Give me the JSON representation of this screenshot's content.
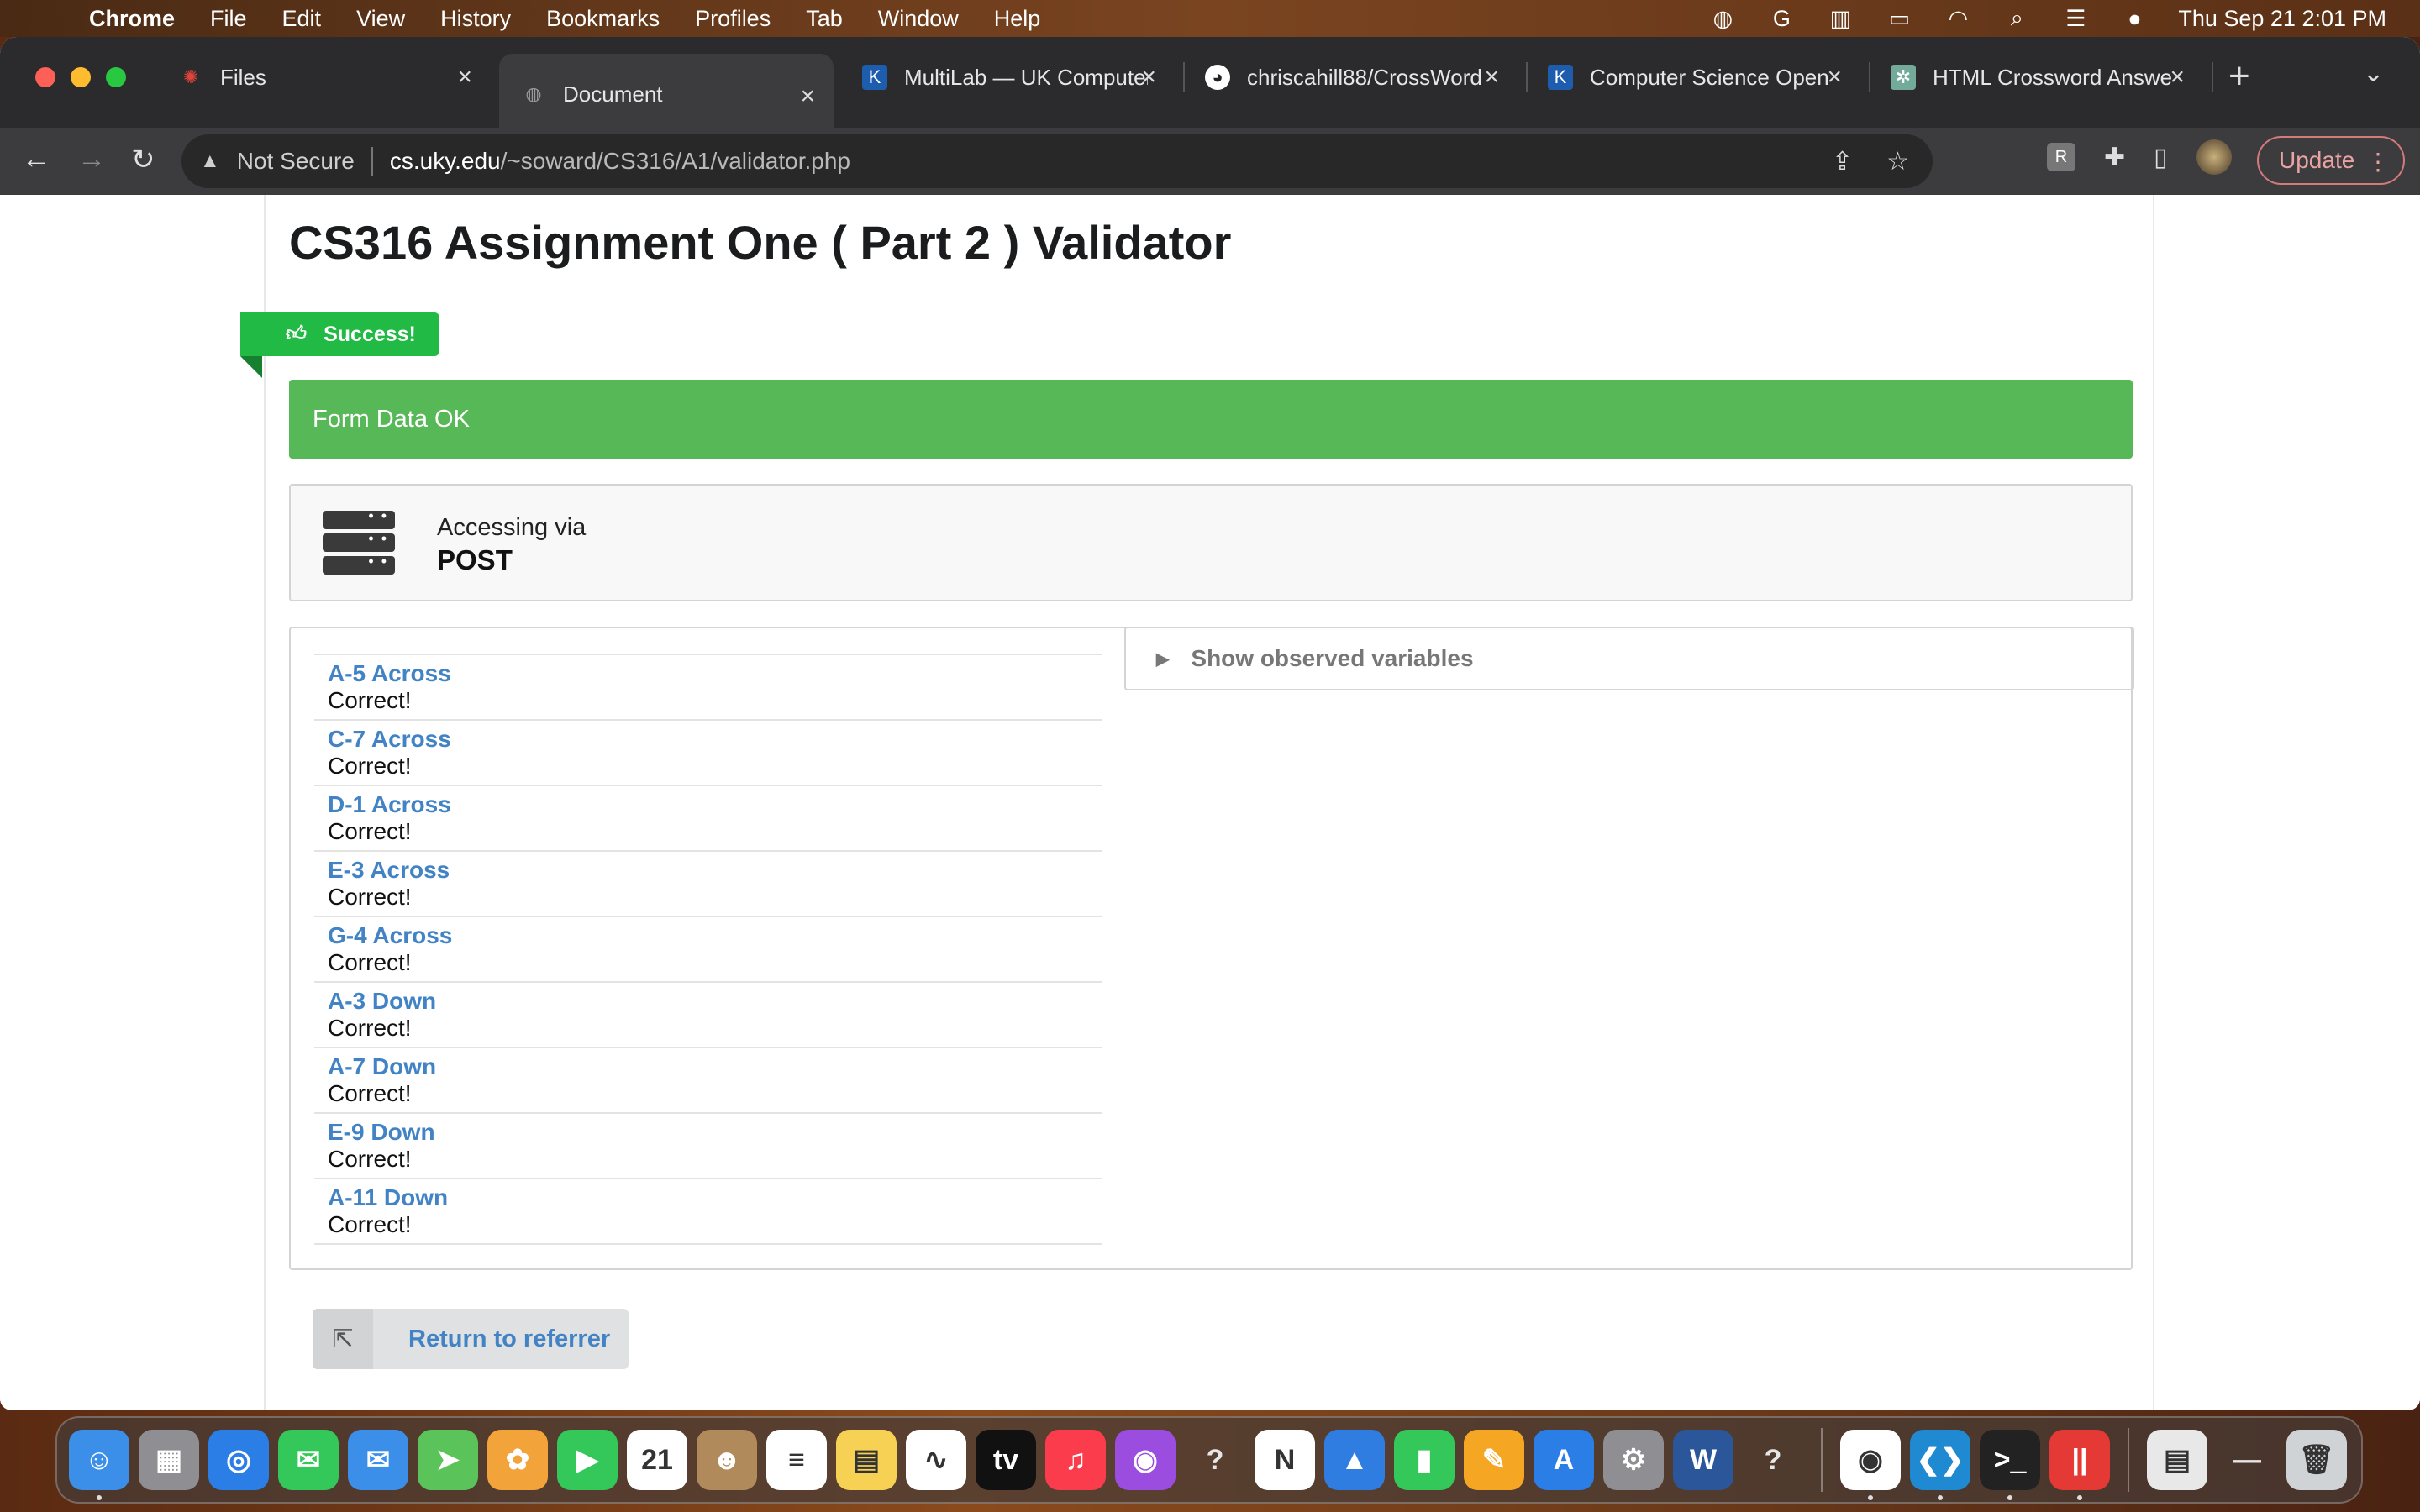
{
  "menubar": {
    "app": "Chrome",
    "items": [
      "File",
      "Edit",
      "View",
      "History",
      "Bookmarks",
      "Profiles",
      "Tab",
      "Window",
      "Help"
    ],
    "clock": "Thu Sep 21  2:01 PM"
  },
  "tabs": [
    {
      "title": "Files",
      "icon": "canvas-icon",
      "color": "#e0443a"
    },
    {
      "title": "Document",
      "icon": "globe-icon",
      "color": "#9a9a9a"
    },
    {
      "title": "MultiLab — UK Computer",
      "icon": "uk-icon",
      "color": "#1e5cae"
    },
    {
      "title": "chriscahill88/CrossWord",
      "icon": "github-icon",
      "color": "#ffffff"
    },
    {
      "title": "Computer Science Open",
      "icon": "uk-icon",
      "color": "#1e5cae"
    },
    {
      "title": "HTML Crossword Answe",
      "icon": "chatgpt-icon",
      "color": "#74aa9c"
    }
  ],
  "omnibox": {
    "security": "Not Secure",
    "host": "cs.uky.edu",
    "path": "/~soward/CS316/A1/validator.php"
  },
  "update_label": "Update",
  "page": {
    "title": "CS316 Assignment One ( Part 2 ) Validator",
    "ribbon": "Success!",
    "form_status": "Form Data OK",
    "method_label": "Accessing via",
    "method_value": "POST",
    "accordion_label": "Show observed variables",
    "results": [
      {
        "name": "A-5 Across",
        "result": "Correct!"
      },
      {
        "name": "C-7 Across",
        "result": "Correct!"
      },
      {
        "name": "D-1 Across",
        "result": "Correct!"
      },
      {
        "name": "E-3 Across",
        "result": "Correct!"
      },
      {
        "name": "G-4 Across",
        "result": "Correct!"
      },
      {
        "name": "A-3 Down",
        "result": "Correct!"
      },
      {
        "name": "A-7 Down",
        "result": "Correct!"
      },
      {
        "name": "E-9 Down",
        "result": "Correct!"
      },
      {
        "name": "A-11 Down",
        "result": "Correct!"
      }
    ],
    "return_label": "Return to referrer"
  },
  "dock": [
    {
      "name": "finder-icon",
      "color": "#3b8fe8",
      "glyph": "☺"
    },
    {
      "name": "launchpad-icon",
      "color": "#8e8e93",
      "glyph": "▦"
    },
    {
      "name": "safari-icon",
      "color": "#2a7ee6",
      "glyph": "◎"
    },
    {
      "name": "messages-icon",
      "color": "#34c759",
      "glyph": "✉"
    },
    {
      "name": "mail-icon",
      "color": "#3b8fe8",
      "glyph": "✉"
    },
    {
      "name": "maps-icon",
      "color": "#5ac35a",
      "glyph": "➤"
    },
    {
      "name": "photos-icon",
      "color": "#f2a33a",
      "glyph": "✿"
    },
    {
      "name": "facetime-icon",
      "color": "#34c759",
      "glyph": "▶"
    },
    {
      "name": "calendar-icon",
      "color": "#ffffff",
      "glyph": "21"
    },
    {
      "name": "contacts-icon",
      "color": "#b08a5a",
      "glyph": "☻"
    },
    {
      "name": "reminders-icon",
      "color": "#ffffff",
      "glyph": "≡"
    },
    {
      "name": "notes-icon",
      "color": "#f7d154",
      "glyph": "▤"
    },
    {
      "name": "freeform-icon",
      "color": "#ffffff",
      "glyph": "∿"
    },
    {
      "name": "tv-icon",
      "color": "#111111",
      "glyph": "tv"
    },
    {
      "name": "music-icon",
      "color": "#fa3c4c",
      "glyph": "♫"
    },
    {
      "name": "podcasts-icon",
      "color": "#9b4de0",
      "glyph": "◉"
    },
    {
      "name": "unknown-app-icon",
      "color": "transparent",
      "glyph": "?"
    },
    {
      "name": "news-icon",
      "color": "#ffffff",
      "glyph": "N"
    },
    {
      "name": "keynote-icon",
      "color": "#2f7de1",
      "glyph": "▲"
    },
    {
      "name": "numbers-icon",
      "color": "#34c759",
      "glyph": "▮"
    },
    {
      "name": "pages-icon",
      "color": "#f5a623",
      "glyph": "✎"
    },
    {
      "name": "app-store-icon",
      "color": "#2a7ee6",
      "glyph": "A"
    },
    {
      "name": "system-settings-icon",
      "color": "#8e8e93",
      "glyph": "⚙"
    },
    {
      "name": "word-icon",
      "color": "#2b579a",
      "glyph": "W"
    },
    {
      "name": "unknown-app-icon-2",
      "color": "transparent",
      "glyph": "?"
    },
    {
      "name": "chrome-icon",
      "color": "#ffffff",
      "glyph": "◉"
    },
    {
      "name": "vscode-icon",
      "color": "#1f8ad2",
      "glyph": "❮❯"
    },
    {
      "name": "terminal-icon",
      "color": "#222222",
      "glyph": ">_"
    },
    {
      "name": "parallels-icon",
      "color": "#e53935",
      "glyph": "||"
    },
    {
      "name": "documents-stack-icon",
      "color": "#e8e8e8",
      "glyph": "▤"
    },
    {
      "name": "downloads-stack-icon",
      "color": "transparent",
      "glyph": "—"
    },
    {
      "name": "trash-icon",
      "color": "#cfd3d6",
      "glyph": "🗑"
    }
  ]
}
